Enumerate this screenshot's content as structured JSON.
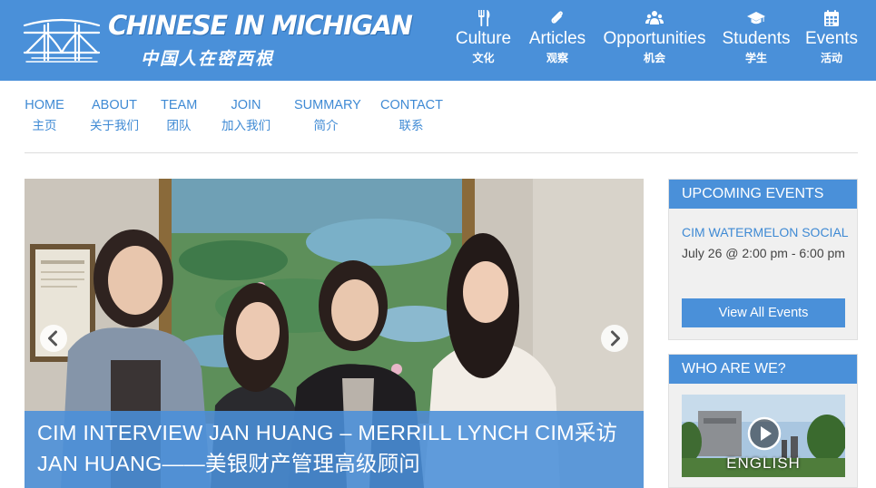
{
  "header": {
    "logo_title": "CHINESE IN MICHIGAN",
    "logo_subtitle": "中国人在密西根",
    "background": "#4a90d9"
  },
  "topnav": [
    {
      "label": "Culture",
      "sub": "文化",
      "icon": "utensils-icon"
    },
    {
      "label": "Articles",
      "sub": "观察",
      "icon": "paperclip-icon"
    },
    {
      "label": "Opportunities",
      "sub": "机会",
      "icon": "users-icon"
    },
    {
      "label": "Students",
      "sub": "学生",
      "icon": "graduation-cap-icon"
    },
    {
      "label": "Events",
      "sub": "活动",
      "icon": "calendar-icon"
    }
  ],
  "mainnav": [
    {
      "label": "HOME",
      "sub": "主页"
    },
    {
      "label": "ABOUT",
      "sub": "关于我们"
    },
    {
      "label": "TEAM",
      "sub": "团队"
    },
    {
      "label": "JOIN",
      "sub": "加入我们"
    },
    {
      "label": "SUMMARY",
      "sub": "简介"
    },
    {
      "label": "CONTACT",
      "sub": "联系"
    }
  ],
  "slider": {
    "caption_line1": "CIM INTERVIEW JAN HUANG – MERRILL LYNCH CIM采访",
    "caption_line2": "JAN HUANG——美银财产管理高级顾问",
    "prev_icon": "chevron-left-icon",
    "next_icon": "chevron-right-icon"
  },
  "sidebar": {
    "events": {
      "title": "UPCOMING EVENTS",
      "event_name": "CIM WATERMELON SOCIAL",
      "event_time": "July 26 @ 2:00 pm - 6:00 pm",
      "button": "View All Events"
    },
    "who": {
      "title": "WHO ARE WE?",
      "video_label": "ENGLISH",
      "play_icon": "play-icon"
    }
  },
  "colors": {
    "accent": "#4a90d9",
    "link": "#3f8ad4",
    "divider": "#dddddd"
  }
}
